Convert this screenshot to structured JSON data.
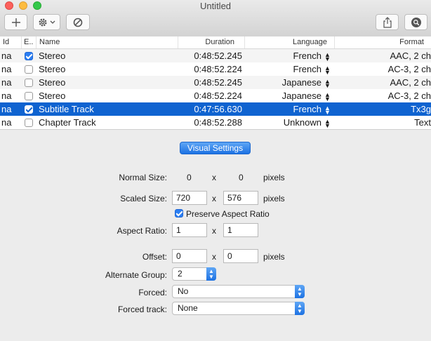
{
  "window": {
    "title": "Untitled"
  },
  "toolbar": {
    "add_icon": "plus-icon",
    "action_icon": "gear-icon",
    "disable_icon": "no-entry-icon",
    "share_icon": "share-icon",
    "inspect_icon": "magnifier-icon"
  },
  "table": {
    "headers": {
      "id": "Id",
      "enabled": "E..",
      "name": "Name",
      "duration": "Duration",
      "language": "Language",
      "format": "Format"
    },
    "rows": [
      {
        "id": "na",
        "enabled": true,
        "name": "Stereo",
        "duration": "0:48:52.245",
        "language": "French",
        "format": "AAC, 2 ch"
      },
      {
        "id": "na",
        "enabled": false,
        "name": "Stereo",
        "duration": "0:48:52.224",
        "language": "French",
        "format": "AC-3, 2 ch"
      },
      {
        "id": "na",
        "enabled": false,
        "name": "Stereo",
        "duration": "0:48:52.245",
        "language": "Japanese",
        "format": "AAC, 2 ch"
      },
      {
        "id": "na",
        "enabled": false,
        "name": "Stereo",
        "duration": "0:48:52.224",
        "language": "Japanese",
        "format": "AC-3, 2 ch"
      },
      {
        "id": "na",
        "enabled": true,
        "name": "Subtitle Track",
        "duration": "0:47:56.630",
        "language": "French",
        "format": "Tx3g"
      },
      {
        "id": "na",
        "enabled": false,
        "name": "Chapter Track",
        "duration": "0:48:52.288",
        "language": "Unknown",
        "format": "Text"
      }
    ],
    "selected_row": 4,
    "stepper_glyph": "▲▼"
  },
  "settings": {
    "tab_label": "Visual Settings",
    "normal_size": {
      "label": "Normal Size:",
      "width": "0",
      "sep": "x",
      "height": "0",
      "unit": "pixels"
    },
    "scaled_size": {
      "label": "Scaled Size:",
      "width": "720",
      "sep": "x",
      "height": "576",
      "unit": "pixels"
    },
    "preserve_aspect": {
      "label": "Preserve Aspect Ratio",
      "checked": true
    },
    "aspect_ratio": {
      "label": "Aspect Ratio:",
      "width": "1",
      "sep": "x",
      "height": "1"
    },
    "offset": {
      "label": "Offset:",
      "x": "0",
      "sep": "x",
      "y": "0",
      "unit": "pixels"
    },
    "alternate_group": {
      "label": "Alternate Group:",
      "value": "2"
    },
    "forced": {
      "label": "Forced:",
      "value": "No"
    },
    "forced_track": {
      "label": "Forced track:",
      "value": "None"
    },
    "popup_arrows": "▲▼"
  },
  "colors": {
    "selection": "#0f63d0",
    "accent": "#2b7ef2",
    "close": "#fc605c",
    "minimize": "#fdbc40",
    "zoom": "#34c84a"
  }
}
